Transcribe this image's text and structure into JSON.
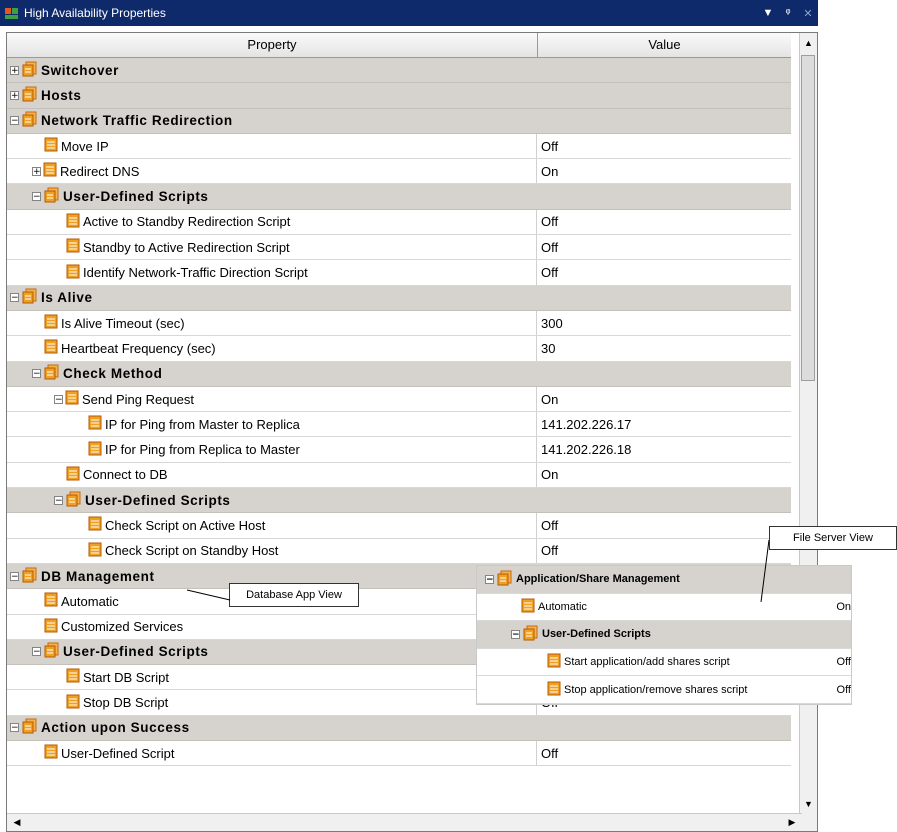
{
  "window": {
    "title": "High Availability Properties",
    "pin_glyph": "↓ & ×"
  },
  "header": {
    "property": "Property",
    "value": "Value"
  },
  "rows": [
    {
      "label": "Switchover",
      "value": "",
      "cat": true,
      "indent": 0,
      "exp": "plus"
    },
    {
      "label": "Hosts",
      "value": "",
      "cat": true,
      "indent": 0,
      "exp": "plus"
    },
    {
      "label": "Network Traffic Redirection",
      "value": "",
      "cat": true,
      "indent": 0,
      "exp": "minus"
    },
    {
      "label": "Move IP",
      "value": "Off",
      "cat": false,
      "indent": 1,
      "exp": ""
    },
    {
      "label": "Redirect DNS",
      "value": "On",
      "cat": false,
      "indent": 1,
      "exp": "plus"
    },
    {
      "label": "User-Defined Scripts",
      "value": "",
      "cat": true,
      "indent": 1,
      "exp": "minus"
    },
    {
      "label": "Active to Standby Redirection Script",
      "value": "Off",
      "cat": false,
      "indent": 2,
      "exp": ""
    },
    {
      "label": "Standby to Active Redirection Script",
      "value": "Off",
      "cat": false,
      "indent": 2,
      "exp": ""
    },
    {
      "label": "Identify Network-Traffic Direction Script",
      "value": "Off",
      "cat": false,
      "indent": 2,
      "exp": ""
    },
    {
      "label": "Is Alive",
      "value": "",
      "cat": true,
      "indent": 0,
      "exp": "minus"
    },
    {
      "label": "Is Alive Timeout (sec)",
      "value": "300",
      "cat": false,
      "indent": 1,
      "exp": ""
    },
    {
      "label": "Heartbeat Frequency (sec)",
      "value": "30",
      "cat": false,
      "indent": 1,
      "exp": ""
    },
    {
      "label": "Check Method",
      "value": "",
      "cat": true,
      "indent": 1,
      "exp": "minus"
    },
    {
      "label": "Send Ping Request",
      "value": "On",
      "cat": false,
      "indent": 2,
      "exp": "minus"
    },
    {
      "label": "IP for Ping from Master to Replica",
      "value": "141.202.226.17",
      "cat": false,
      "indent": 3,
      "exp": ""
    },
    {
      "label": "IP for Ping from Replica to Master",
      "value": "141.202.226.18",
      "cat": false,
      "indent": 3,
      "exp": ""
    },
    {
      "label": "Connect to DB",
      "value": "On",
      "cat": false,
      "indent": 2,
      "exp": ""
    },
    {
      "label": "User-Defined Scripts",
      "value": "",
      "cat": true,
      "indent": 2,
      "exp": "minus"
    },
    {
      "label": "Check Script on Active Host",
      "value": "Off",
      "cat": false,
      "indent": 3,
      "exp": ""
    },
    {
      "label": "Check Script on Standby Host",
      "value": "Off",
      "cat": false,
      "indent": 3,
      "exp": ""
    },
    {
      "label": "DB Management",
      "value": "",
      "cat": true,
      "indent": 0,
      "exp": "minus"
    },
    {
      "label": "Automatic",
      "value": "",
      "cat": false,
      "indent": 1,
      "exp": ""
    },
    {
      "label": "Customized Services",
      "value": "",
      "cat": false,
      "indent": 1,
      "exp": ""
    },
    {
      "label": "User-Defined Scripts",
      "value": "",
      "cat": true,
      "indent": 1,
      "exp": "minus"
    },
    {
      "label": "Start DB Script",
      "value": "",
      "cat": false,
      "indent": 2,
      "exp": ""
    },
    {
      "label": "Stop DB Script",
      "value": "Off",
      "cat": false,
      "indent": 2,
      "exp": ""
    },
    {
      "label": "Action upon Success",
      "value": "",
      "cat": true,
      "indent": 0,
      "exp": "minus"
    },
    {
      "label": "User-Defined Script",
      "value": "Off",
      "cat": false,
      "indent": 1,
      "exp": ""
    }
  ],
  "file_server_overlay": {
    "rows": [
      {
        "label": "Application/Share Management",
        "value": "",
        "cat": true,
        "indent": 0,
        "exp": "minus"
      },
      {
        "label": "Automatic",
        "value": "On",
        "cat": false,
        "indent": 1,
        "exp": ""
      },
      {
        "label": "User-Defined Scripts",
        "value": "",
        "cat": true,
        "indent": 1,
        "exp": "minus"
      },
      {
        "label": "Start application/add shares script",
        "value": "Off",
        "cat": false,
        "indent": 2,
        "exp": ""
      },
      {
        "label": "Stop application/remove shares script",
        "value": "Off",
        "cat": false,
        "indent": 2,
        "exp": ""
      }
    ]
  },
  "annotations": {
    "database_app_view": "Database App View",
    "file_server_view": "File Server View"
  },
  "colors": {
    "title_bg": "#0f2a6a",
    "category_bg": "#d6d3ce",
    "icon_orange": "#f0a020"
  }
}
